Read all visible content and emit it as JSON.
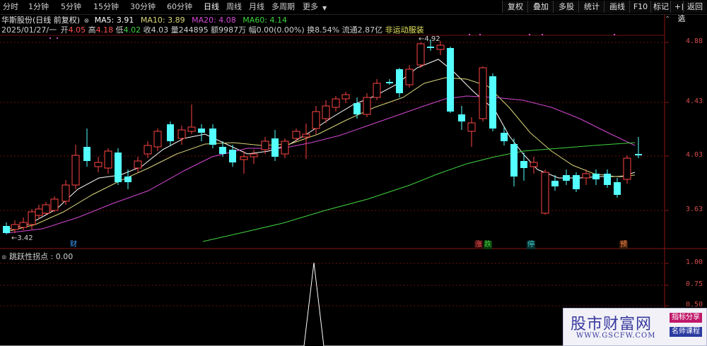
{
  "toolbar": {
    "periods": [
      "分时",
      "1分钟",
      "5分钟",
      "15分钟",
      "30分钟",
      "60分钟",
      "日线",
      "周线",
      "月线",
      "多周期",
      "更多"
    ],
    "active_period": "日线",
    "right_buttons": [
      "复权",
      "叠加",
      "多股",
      "统计",
      "画线",
      "F10",
      "标记",
      "+自选",
      "返回"
    ]
  },
  "stock": {
    "title": "华斯股份(日线 前复权)",
    "date": "2025/01/27/一",
    "open_label": "开",
    "open": "4.05",
    "high_label": "高",
    "high": "4.18",
    "low_label": "低",
    "low": "4.02",
    "close_label": "收",
    "close": "4.03",
    "volume_label": "量",
    "volume": "244895",
    "amount_label": "额",
    "amount": "9987万",
    "change_label": "幅",
    "change": "0.00(0.00%)",
    "turnover_label": "换",
    "turnover": "8.54%",
    "float_label": "流通",
    "float": "2.87亿",
    "concept": "非运动服装"
  },
  "ma": {
    "ma5": "MA5: 3.91",
    "ma10": "MA10: 3.89",
    "ma20": "MA20: 4.08",
    "ma60": "MA60: 4.14",
    "colors": {
      "ma5": "#ffffff",
      "ma10": "#d9d57a",
      "ma20": "#d448d4",
      "ma60": "#3fd43f"
    }
  },
  "price_axis": [
    "4.88",
    "4.43",
    "4.03",
    "3.63"
  ],
  "annotations": {
    "high": "4.92",
    "low": "3.42"
  },
  "markers": [
    {
      "text": "财",
      "color": "#3fa0ff",
      "bg": "#0a1a3a"
    },
    {
      "text": "涨",
      "color": "#ff5a5a",
      "bg": "#3a0a0a"
    },
    {
      "text": "跌",
      "color": "#3fd43f",
      "bg": "#0a3a0a"
    },
    {
      "text": "停",
      "color": "#3fd4d4",
      "bg": "#0a3030"
    },
    {
      "text": "预",
      "color": "#ff8a4a",
      "bg": "#3a1a0a"
    }
  ],
  "indicator": {
    "title": "跳跃性拐点 : 0.00",
    "axis": [
      "1.00",
      "0.75",
      "0.50"
    ]
  },
  "watermark": {
    "title": "股市财富网",
    "url": "WWW.GSCFW.COM",
    "tag1": "指标分享",
    "tag2": "名师课程"
  },
  "colors": {
    "up": "#ff4040",
    "down": "#54ffff",
    "axis": "#d24b4b"
  }
}
